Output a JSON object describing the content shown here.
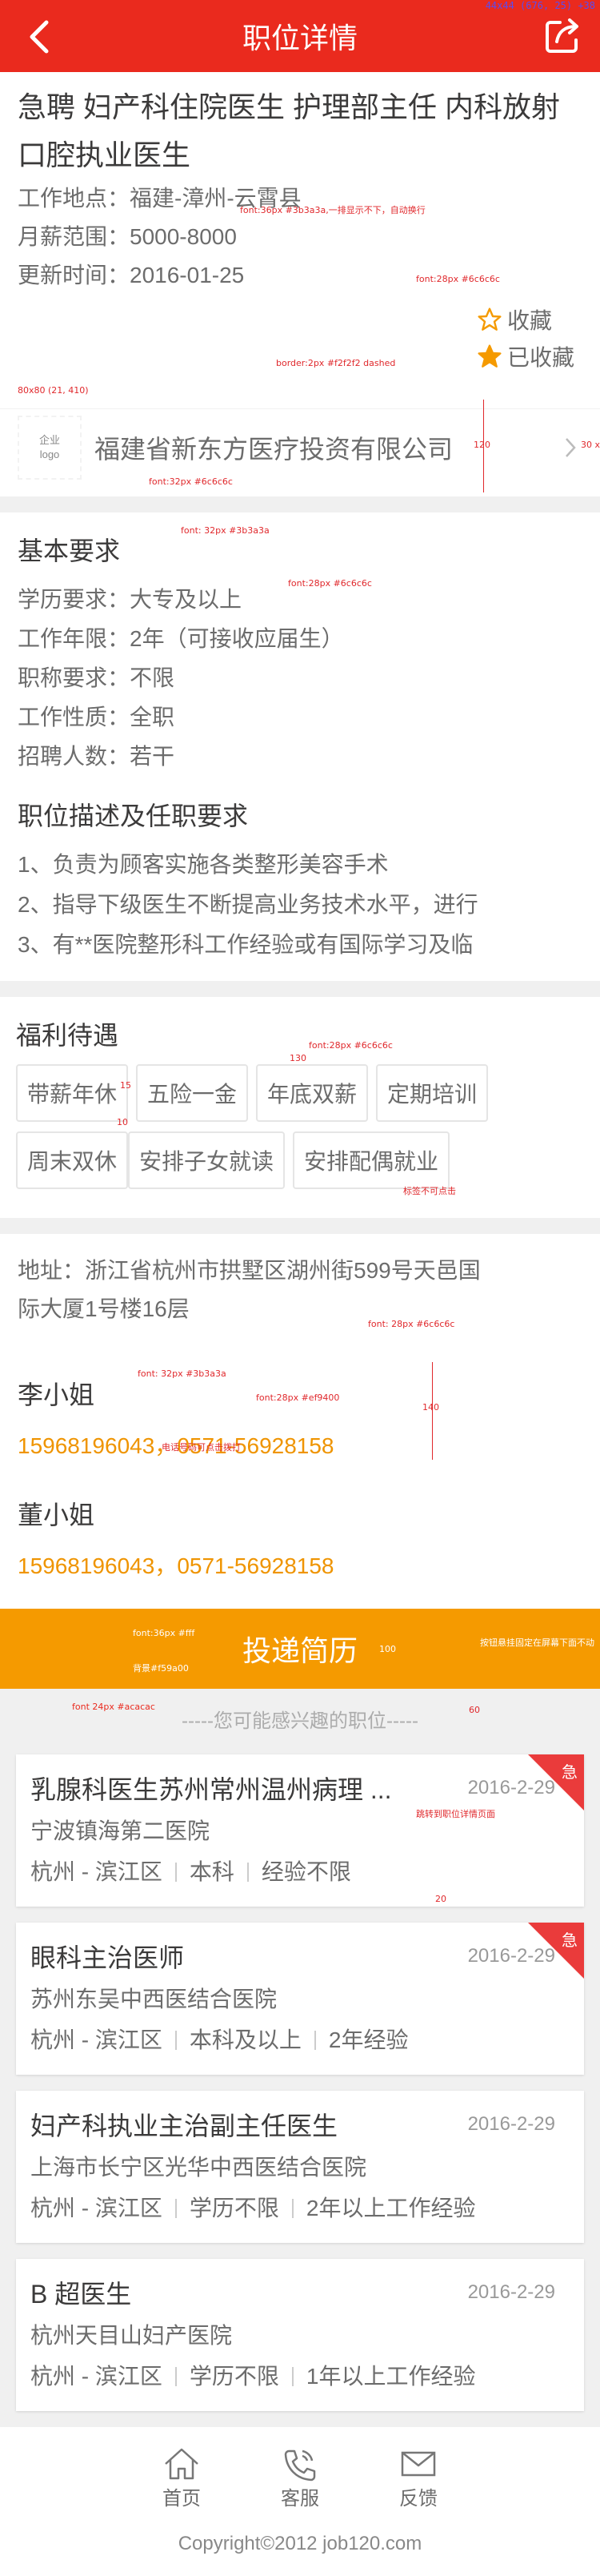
{
  "header": {
    "title": "职位详情",
    "back_icon": "back-arrow-icon",
    "share_icon": "share-icon",
    "device_size_note": "44x44 (676, 25)",
    "device_corner_note": "+38"
  },
  "job": {
    "title": "急聘 妇产科住院医生 护理部主任 内科放射口腔执业医生",
    "location_label": "工作地点：",
    "location": "福建-漳州-云霄县",
    "salary_label": "月薪范围：",
    "salary": "5000-8000",
    "updated_label": "更新时间：",
    "updated": "2016-01-25",
    "favorite_label": "收藏",
    "favorited_label": "已收藏",
    "star_color": "#f59a00"
  },
  "company": {
    "logo_label_1": "企业",
    "logo_label_2": "logo",
    "name": "福建省新东方医疗投资有限公司"
  },
  "requirements": {
    "heading": "基本要求",
    "items": [
      {
        "label": "学历要求：",
        "value": "大专及以上"
      },
      {
        "label": "工作年限：",
        "value": "2年（可接收应届生）"
      },
      {
        "label": "职称要求：",
        "value": "不限"
      },
      {
        "label": "工作性质：",
        "value": "全职"
      },
      {
        "label": "招聘人数：",
        "value": "若干"
      }
    ]
  },
  "description": {
    "heading": "职位描述及任职要求",
    "lines": [
      "1、负责为顾客实施各类整形美容手术",
      "2、指导下级医生不断提高业务技术水平，进行",
      "3、有**医院整形科工作经验或有国际学习及临"
    ]
  },
  "benefits": {
    "heading": "福利待遇",
    "tags": [
      "带薪年休",
      "五险一金",
      "年底双薪",
      "定期培训",
      "周末双休",
      "安排子女就读",
      "安排配偶就业"
    ]
  },
  "contact": {
    "address": "地址：浙江省杭州市拱墅区湖州街599号天邑国际大厦1号楼16层",
    "address_line1": "地址：浙江省杭州市拱墅区湖州街599号天邑国",
    "address_line2": "际大厦1号楼16层",
    "people": [
      {
        "name": "李小姐",
        "phone1": "15968196043",
        "phone2": "0571-56928158"
      },
      {
        "name": "董小姐",
        "phone1": "15968196043",
        "phone2": "0571-56928158"
      }
    ],
    "separator": "，"
  },
  "submit": {
    "label": "投递简历",
    "color": "#f59a00"
  },
  "recommend": {
    "heading": "-----您可能感兴趣的职位-----",
    "jobs": [
      {
        "title": "乳腺科医生苏州常州温州病理 ...",
        "date": "2016-2-29",
        "company": "宁波镇海第二医院",
        "city": "杭州 - 滨江区",
        "edu": "本科",
        "exp": "经验不限",
        "urgent": "急"
      },
      {
        "title": "眼科主治医师",
        "date": "2016-2-29",
        "company": "苏州东吴中西医结合医院",
        "city": "杭州 - 滨江区",
        "edu": "本科及以上",
        "exp": "2年经验",
        "urgent": "急"
      },
      {
        "title": "妇产科执业主治副主任医生",
        "date": "2016-2-29",
        "company": "上海市长宁区光华中西医结合医院",
        "city": "杭州 - 滨江区",
        "edu": "学历不限",
        "exp": "2年以上工作经验",
        "urgent": ""
      },
      {
        "title": "B 超医生",
        "date": "2016-2-29",
        "company": "杭州天目山妇产医院",
        "city": "杭州 - 滨江区",
        "edu": "学历不限",
        "exp": "1年以上工作经验",
        "urgent": ""
      }
    ]
  },
  "footer": {
    "nav": [
      {
        "label": "首页",
        "icon": "home-icon"
      },
      {
        "label": "客服",
        "icon": "phone-icon"
      },
      {
        "label": "反馈",
        "icon": "mail-icon"
      }
    ],
    "copyright": "Copyright©2012  job120.com"
  },
  "annotations": {
    "title_font": "font:36px #3b3a3a,一排显示不下，自动换行",
    "info_font": "font: 28px #6c6c6c",
    "fav_font": "font:28px #6c6c6c",
    "border_note": "border:2px #f2f2f2 dashed",
    "logo_size": "80x80 (21, 410)",
    "company_font": "font:32px #6c6c6c",
    "company_height": "120",
    "chevron_size": "30 x",
    "heading_font": "font: 32px #3b3a3a",
    "req_font": "font:28px #6c6c6c",
    "tag_font": "font:28px #6c6c6c",
    "tag_width": "130",
    "tag_height": "15",
    "tag_gap": "10",
    "tag_note": "标签不可点击",
    "addr_font": "font: 28px #6c6c6c",
    "name_font": "font: 32px #3b3a3a",
    "phone_font": "font:28px #ef9400",
    "contact_height": "140",
    "phone_note": "电话号码可点击拨打",
    "submit_font": "font:36px #fff",
    "submit_bg": "背景#f59a00",
    "submit_height": "100",
    "submit_note": "按钮悬挂固定在屏幕下面不动",
    "interest_font": "font 24px #acacac",
    "interest_gap": "60",
    "link_note": "跳转到职位详情页面",
    "card_gap": "20"
  }
}
